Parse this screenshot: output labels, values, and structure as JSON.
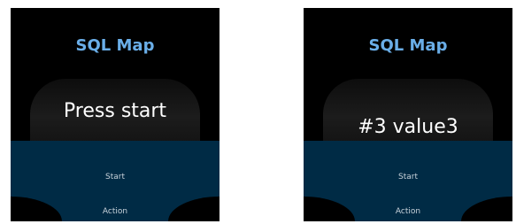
{
  "screens": [
    {
      "title": "SQL Map",
      "main_text": "Press start",
      "start_label": "Start",
      "action_label": "Action"
    },
    {
      "title": "SQL Map",
      "main_text": "#3 value3",
      "start_label": "Start",
      "action_label": "Action"
    }
  ],
  "colors": {
    "title": "#6aaee8",
    "panel": "#002b45",
    "background": "#000000"
  }
}
